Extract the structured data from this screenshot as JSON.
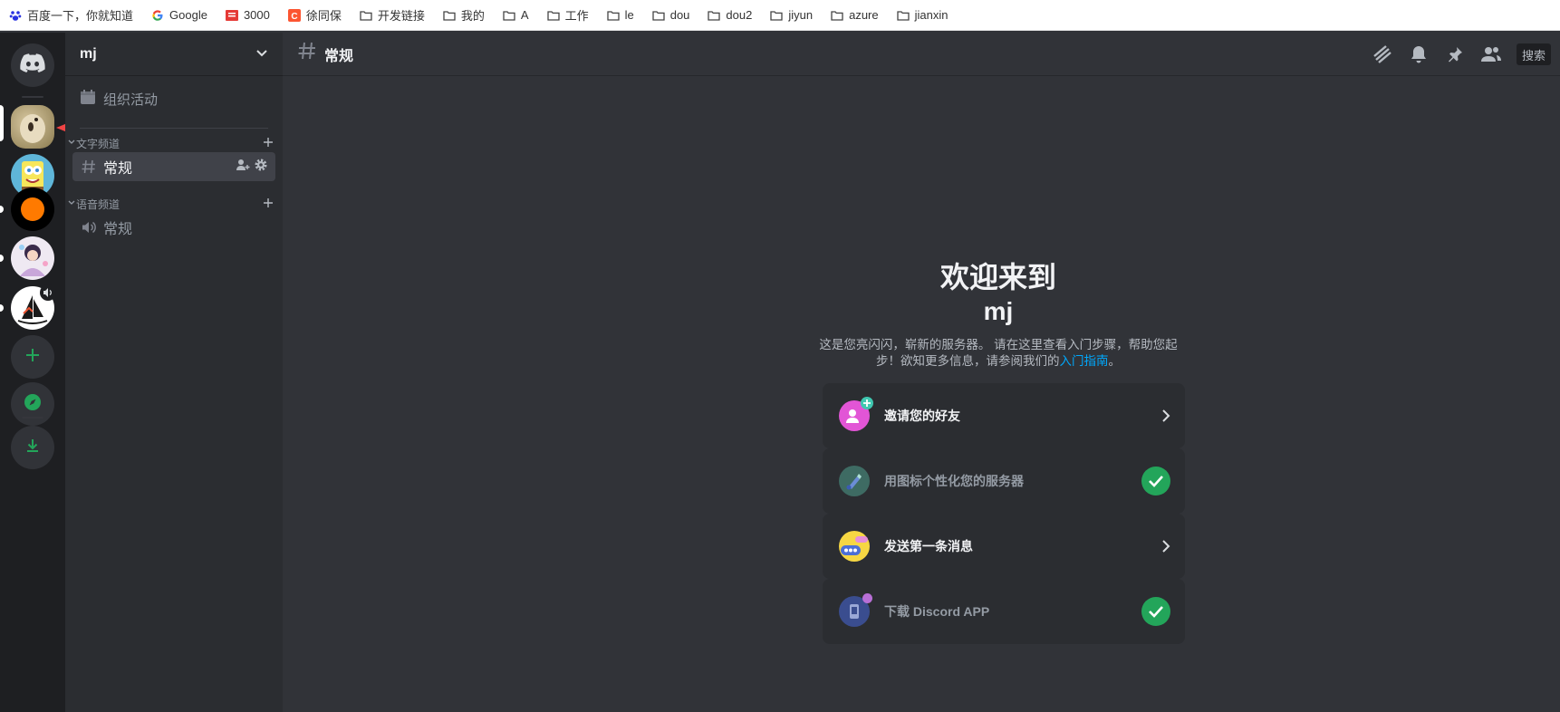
{
  "bookmarks": [
    {
      "label": "百度一下，你就知道",
      "icon": "baidu-icon"
    },
    {
      "label": "Google",
      "icon": "google-icon"
    },
    {
      "label": "3000",
      "icon": "red-square-icon"
    },
    {
      "label": "徐同保",
      "icon": "csdn-icon"
    },
    {
      "label": "开发链接",
      "icon": "folder-icon"
    },
    {
      "label": "我的",
      "icon": "folder-icon"
    },
    {
      "label": "A",
      "icon": "folder-icon"
    },
    {
      "label": "工作",
      "icon": "folder-icon"
    },
    {
      "label": "le",
      "icon": "folder-icon"
    },
    {
      "label": "dou",
      "icon": "folder-icon"
    },
    {
      "label": "dou2",
      "icon": "folder-icon"
    },
    {
      "label": "jiyun",
      "icon": "folder-icon"
    },
    {
      "label": "azure",
      "icon": "folder-icon"
    },
    {
      "label": "jianxin",
      "icon": "folder-icon"
    }
  ],
  "rail": {
    "home_icon": "discord-logo-icon",
    "servers": [
      {
        "name": "server-dog-avatar",
        "selected": true
      },
      {
        "name": "server-spongebob-avatar"
      },
      {
        "name": "server-orange-dot-avatar"
      },
      {
        "name": "server-anime-avatar"
      },
      {
        "name": "server-midjourney-avatar"
      }
    ],
    "add_server_icon": "plus-icon",
    "explore_icon": "compass-icon",
    "download_icon": "download-icon"
  },
  "sidebar": {
    "server_name": "mj",
    "events_label": "组织活动",
    "text_category": "文字频道",
    "voice_category": "语音频道",
    "text_channels": [
      {
        "name": "常规"
      }
    ],
    "voice_channels": [
      {
        "name": "常规"
      }
    ]
  },
  "header": {
    "channel_name": "常规",
    "search_placeholder": "搜索"
  },
  "welcome": {
    "title": "欢迎来到",
    "server": "mj",
    "desc_1": "这是您亮闪闪，崭新的服务器。 请在这里查看入门步骤，帮助您起步！欲知更多信息，请参阅我们的",
    "link": "入门指南",
    "desc_end": "。"
  },
  "checklist": [
    {
      "label": "邀请您的好友",
      "done": false,
      "icon": "invite-friends-icon"
    },
    {
      "label": "用图标个性化您的服务器",
      "done": true,
      "icon": "personalize-icon"
    },
    {
      "label": "发送第一条消息",
      "done": false,
      "icon": "send-message-icon"
    },
    {
      "label": "下载 Discord APP",
      "done": true,
      "icon": "download-app-icon"
    }
  ],
  "colors": {
    "accent_green": "#23a55a",
    "link_blue": "#00a8fc",
    "annotation_red": "#ef4444"
  }
}
